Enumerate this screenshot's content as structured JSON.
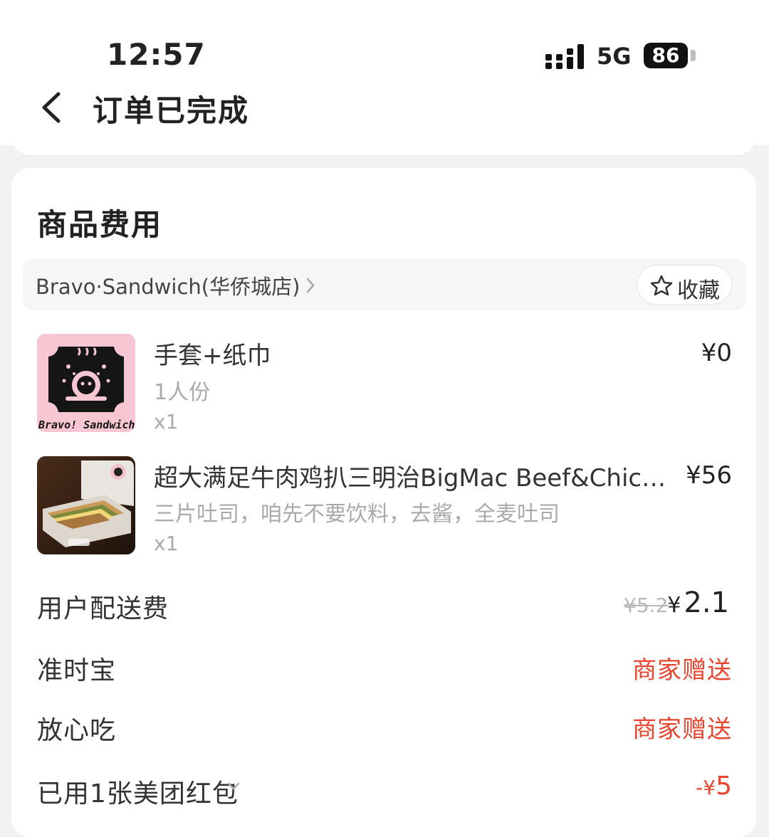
{
  "status_bar": {
    "time": "12:57",
    "network": "5G",
    "battery": "86"
  },
  "header": {
    "title": "订单已完成"
  },
  "fees_section": {
    "title": "商品费用",
    "store": {
      "name": "Bravo·Sandwich(华侨城店)",
      "favorite_label": "收藏"
    },
    "items": [
      {
        "name": "手套+纸巾",
        "spec": "1人份",
        "qty": "x1",
        "price": "¥0",
        "thumb_caption": "Bravo! Sandwich"
      },
      {
        "name": "超大满足牛肉鸡扒三明治BigMac Beef&Chic…",
        "spec": "三片吐司，咱先不要饮料，去酱，全麦吐司",
        "qty": "x1",
        "price": "¥56"
      }
    ],
    "rows": {
      "delivery_label": "用户配送费",
      "delivery_old_price": "¥5.2",
      "delivery_currency": "¥",
      "delivery_price": "2.1",
      "ontime_label": "准时宝",
      "ontime_value": "商家赠送",
      "safe_label": "放心吃",
      "safe_value": "商家赠送",
      "redpack_label": "已用1张美团红包",
      "redpack_prefix": "-¥",
      "redpack_value": "5"
    }
  },
  "colors": {
    "accent_red": "#e8442e",
    "thumb_pink": "#f7c6d3"
  }
}
